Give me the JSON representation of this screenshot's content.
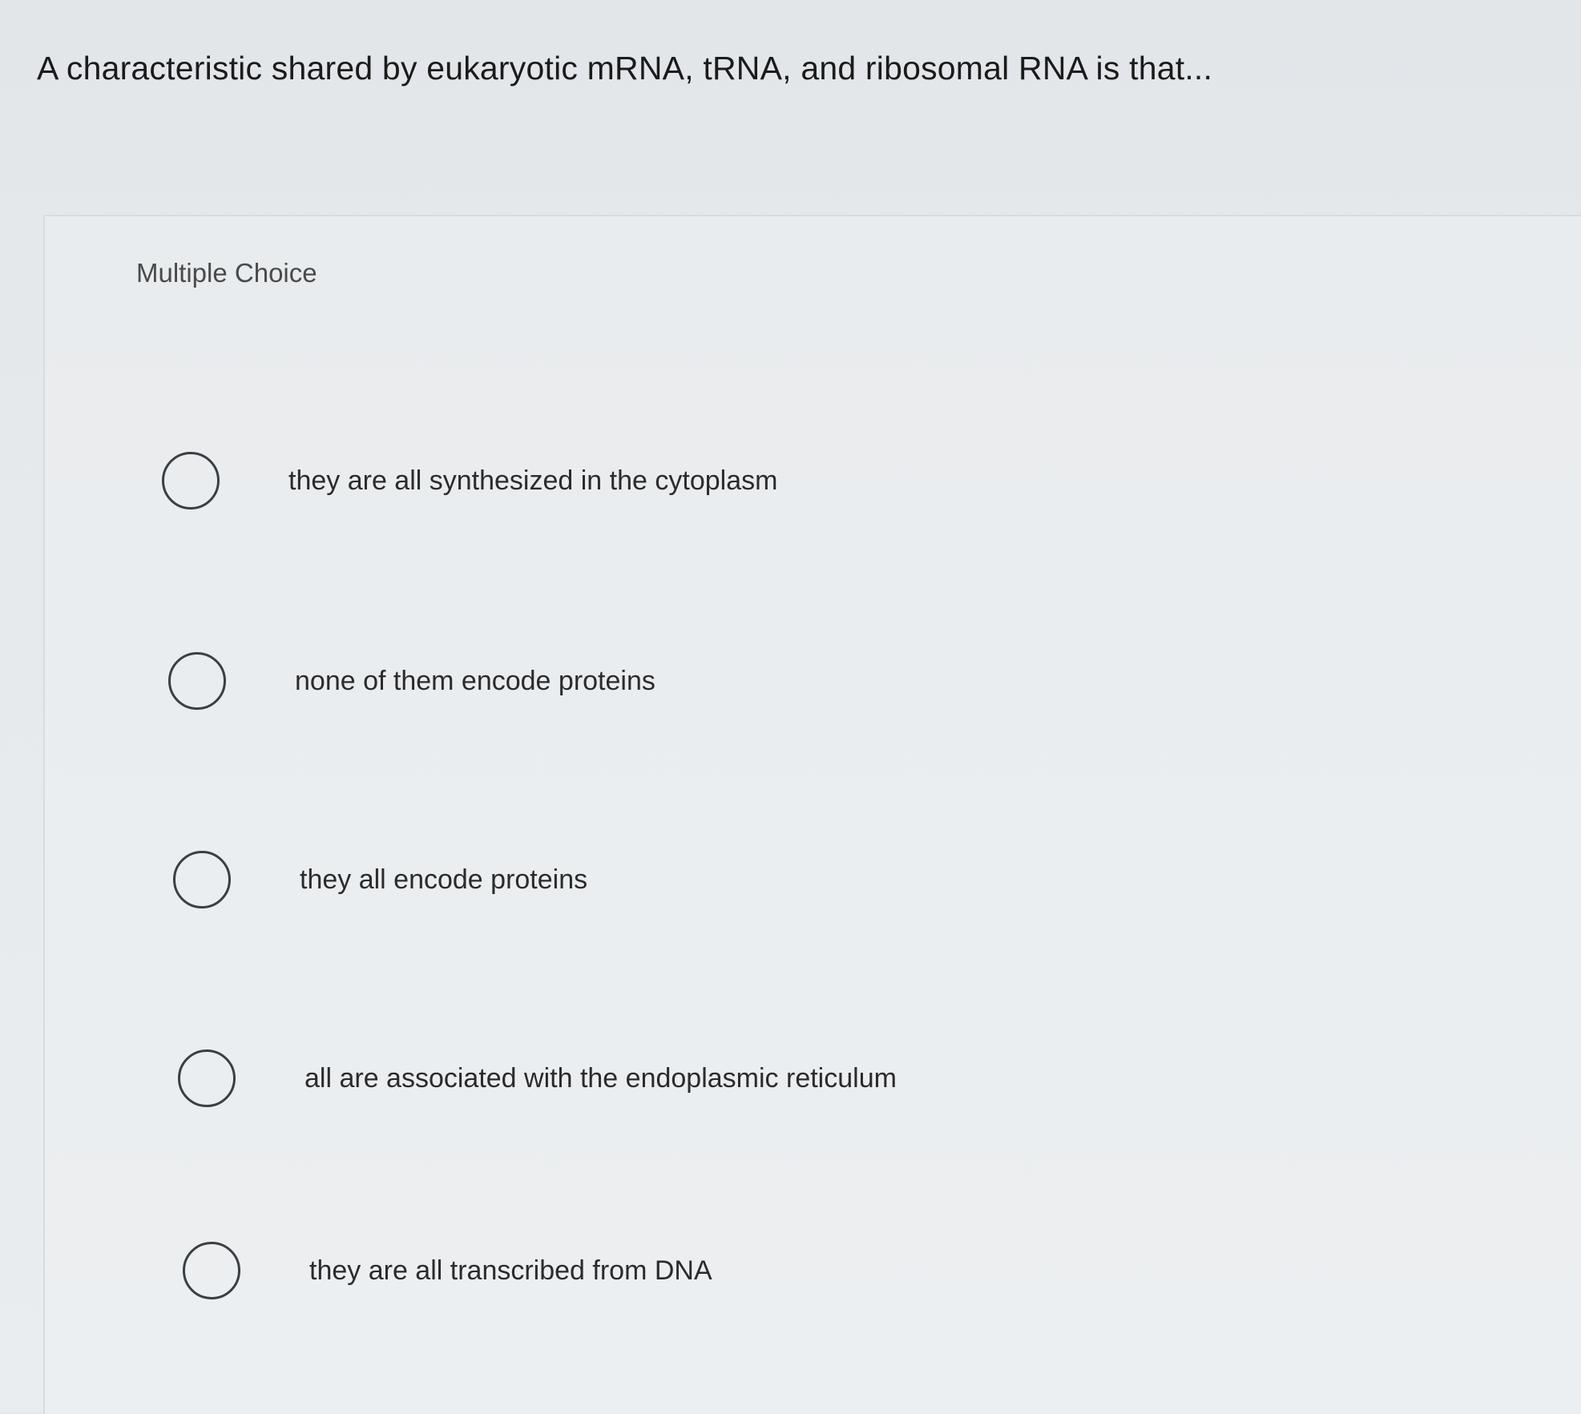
{
  "question": {
    "text": "A characteristic shared by eukaryotic mRNA, tRNA, and ribosomal RNA is that..."
  },
  "panel": {
    "type_label": "Multiple Choice",
    "options": [
      {
        "label": "they are all synthesized in the cytoplasm",
        "selected": false
      },
      {
        "label": "none of them encode proteins",
        "selected": false
      },
      {
        "label": "they all encode proteins",
        "selected": false
      },
      {
        "label": "all are associated with the endoplasmic reticulum",
        "selected": false
      },
      {
        "label": "they are all transcribed from DNA",
        "selected": false
      }
    ]
  }
}
